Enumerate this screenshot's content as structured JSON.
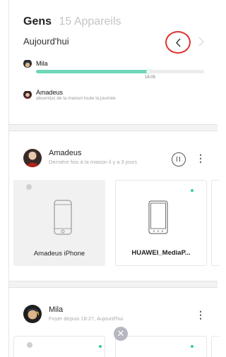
{
  "header": {
    "title": "Gens",
    "device_count": "15 Appareils",
    "day": "Aujourd'hui"
  },
  "timeline": [
    {
      "name": "Mila",
      "progress": 0.67,
      "time": "16:05"
    },
    {
      "name": "Amadeus",
      "status": "absent(e) de la maison toute la journée"
    }
  ],
  "cards": [
    {
      "name": "Amadeus",
      "last_seen": "Dernière fois à la maison il y a 3 jours",
      "devices": [
        {
          "label": "Amadeus iPhone",
          "icon": "iphone-icon",
          "online": false
        },
        {
          "label": "HUAWEI_MediaP...",
          "icon": "tablet-icon",
          "online": true
        }
      ]
    },
    {
      "name": "Mila",
      "last_seen": "Foyer depuis 18:27, Aujourd'hui"
    }
  ],
  "colors": {
    "accent": "#6ED7B9",
    "online_dot": "#36C9A7",
    "highlight_circle": "#E0332E"
  }
}
